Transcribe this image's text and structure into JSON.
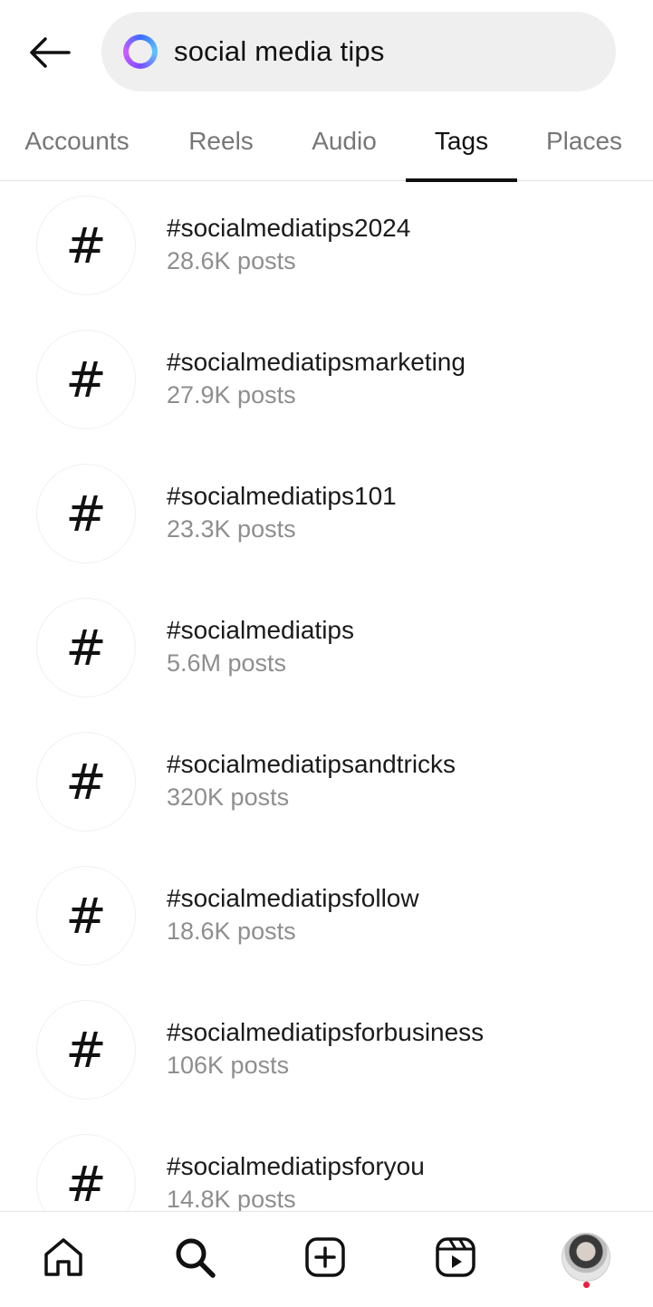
{
  "header": {
    "back_icon": "arrow-left-icon",
    "search": {
      "value": "social media tips",
      "ai_icon": "meta-ai-ring-icon",
      "ring_colors": [
        "#3b6bff",
        "#5cc8ff",
        "#7a4dff",
        "#d05cff"
      ]
    }
  },
  "tabs": [
    {
      "label": "Accounts",
      "active": false
    },
    {
      "label": "Reels",
      "active": false
    },
    {
      "label": "Audio",
      "active": false
    },
    {
      "label": "Tags",
      "active": true
    },
    {
      "label": "Places",
      "active": false
    }
  ],
  "tags": [
    {
      "name": "#socialmediatips2024",
      "count": "28.6K posts"
    },
    {
      "name": "#socialmediatipsmarketing",
      "count": "27.9K posts"
    },
    {
      "name": "#socialmediatips101",
      "count": "23.3K posts"
    },
    {
      "name": "#socialmediatips",
      "count": "5.6M posts"
    },
    {
      "name": "#socialmediatipsandtricks",
      "count": "320K posts"
    },
    {
      "name": "#socialmediatipsfollow",
      "count": "18.6K posts"
    },
    {
      "name": "#socialmediatipsforbusiness",
      "count": "106K posts"
    },
    {
      "name": "#socialmediatipsforyou",
      "count": "14.8K posts"
    }
  ],
  "hash_symbol": "#",
  "bottom_nav": {
    "items": [
      "home-icon",
      "search-icon",
      "create-icon",
      "reels-icon",
      "profile-avatar"
    ],
    "notification_color": "#ed1c3c"
  }
}
